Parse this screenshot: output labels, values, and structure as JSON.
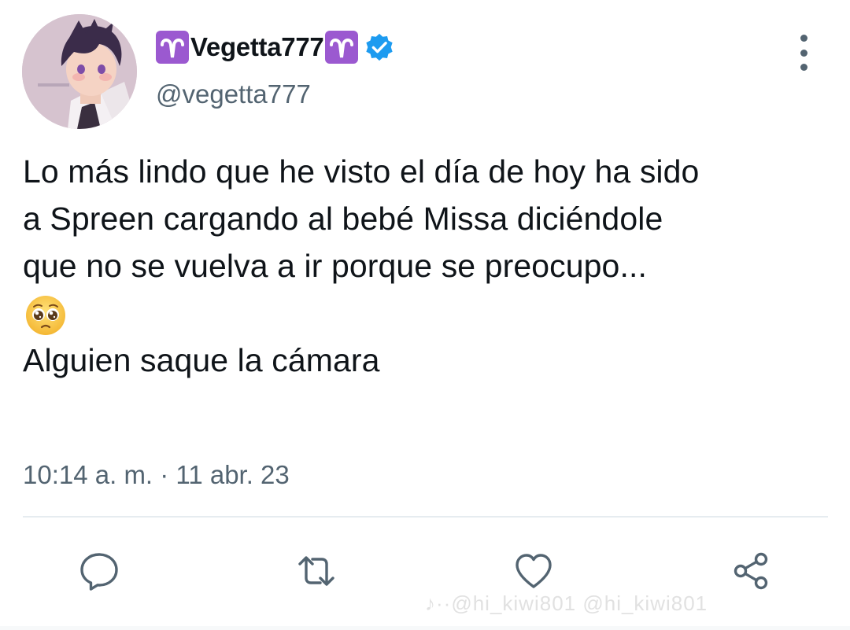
{
  "tweet": {
    "author": {
      "display_name": "Vegetta777",
      "handle": "@vegetta777",
      "name_prefix_icon": "aries-emoji-icon",
      "name_suffix_icon": "aries-emoji-icon",
      "verified": true,
      "avatar_icon": "anime-avatar-image"
    },
    "text_lines": [
      "Lo más lindo que he visto el día de hoy ha sido",
      "a Spreen cargando al bebé Missa diciéndole",
      "que no se vuelva a ir porque se preocupo..."
    ],
    "emoji_line_icon": "pleading-face-emoji-icon",
    "text_last_line": "Alguien saque la cámara",
    "timestamp": "10:14 a. m. · 11 abr. 23"
  },
  "actions": [
    {
      "name": "reply",
      "icon": "comment-icon"
    },
    {
      "name": "retweet",
      "icon": "retweet-icon"
    },
    {
      "name": "like",
      "icon": "heart-icon"
    },
    {
      "name": "share",
      "icon": "share-icon"
    }
  ],
  "watermark": {
    "text": "♪··@hi_kiwi801 @hi_kiwi801"
  },
  "colors": {
    "text_primary": "#0f1419",
    "text_secondary": "#536471",
    "verified_blue": "#1d9bf0",
    "aries_purple": "#9b59d0",
    "divider": "#e6ecf0"
  }
}
